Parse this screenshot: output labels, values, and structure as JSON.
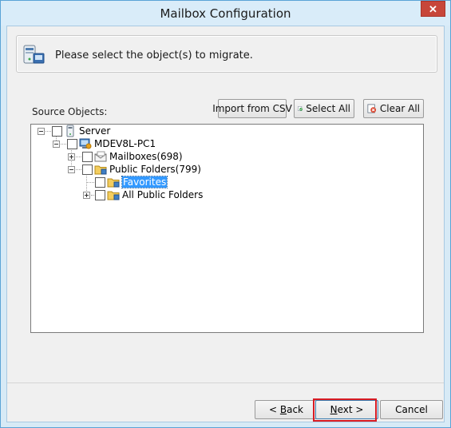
{
  "window": {
    "title": "Mailbox Configuration",
    "close_glyph": "✕"
  },
  "header": {
    "instruction": "Please select the object(s) to migrate."
  },
  "source": {
    "label": "Source Objects:",
    "import_button": "Import from CSV",
    "select_all_button": "Select All",
    "clear_all_button": "Clear All"
  },
  "tree": {
    "nodes": [
      {
        "label": "Server",
        "icon": "server-icon",
        "expanded": true,
        "checked": false
      },
      {
        "label": "MDEV8L-PC1",
        "icon": "computer-icon",
        "expanded": true,
        "checked": false
      },
      {
        "label": "Mailboxes(698)",
        "icon": "mailboxes-icon",
        "expanded": false,
        "checked": false
      },
      {
        "label": "Public Folders(799)",
        "icon": "folder-icon",
        "expanded": true,
        "checked": false
      },
      {
        "label": "Favorites",
        "icon": "folder-icon",
        "selected": true,
        "checked": false
      },
      {
        "label": "All Public Folders",
        "icon": "folder-icon",
        "expanded": false,
        "checked": false
      }
    ]
  },
  "footer": {
    "back_prefix": "< ",
    "back_key": "B",
    "back_rest": "ack",
    "next_key": "N",
    "next_rest": "ext >",
    "cancel": "Cancel"
  },
  "colors": {
    "selection": "#3399ff",
    "highlight_box": "#d81c24",
    "title_bar": "#d9ecf9"
  }
}
